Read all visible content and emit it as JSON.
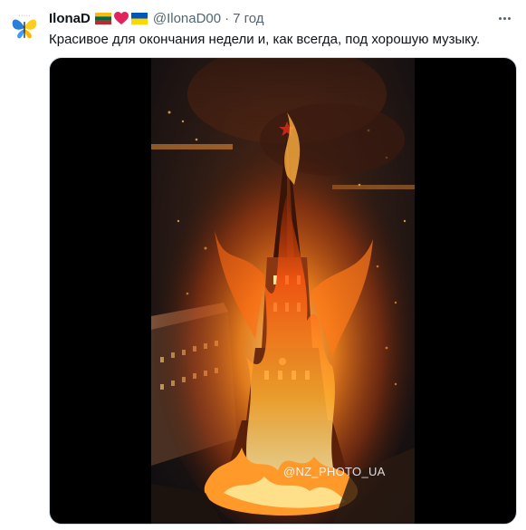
{
  "tweet": {
    "display_name": "IlonaD",
    "name_emojis": [
      "lithuania-flag",
      "red-heart",
      "ukraine-flag"
    ],
    "handle": "@IlonaD00",
    "separator": "·",
    "time": "7 год",
    "text": "Красивое для окончания недели и, как всегда, под хорошую музыку.",
    "media": {
      "watermark": "@NZ_PHOTO_UA",
      "description_icon": "burning-kremlin-tower-image"
    }
  },
  "colors": {
    "text_primary": "#0f1419",
    "text_secondary": "#536471",
    "media_background": "#000000",
    "fire_orange": "#ff7a1a",
    "flag_lithuania": [
      "#fdb913",
      "#006a44",
      "#c1272d"
    ],
    "flag_ukraine": [
      "#0057b7",
      "#ffd700"
    ],
    "heart_red": "#e0245e"
  }
}
